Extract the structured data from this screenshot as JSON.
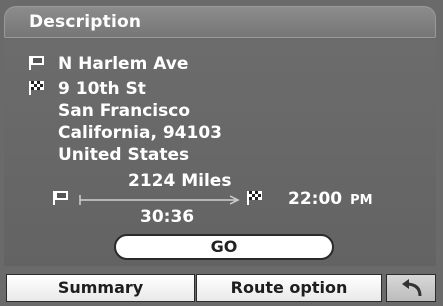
{
  "title": "Description",
  "origin": {
    "street": "N Harlem Ave",
    "icon": "start-flag-icon"
  },
  "destination": {
    "icon": "finish-flag-icon",
    "address_lines": [
      "9 10th St",
      "San Francisco",
      "California, 94103",
      "United States"
    ]
  },
  "route": {
    "distance": "2124 Miles",
    "duration": "30:36",
    "arrival_time": "22:00",
    "arrival_ampm": "PM"
  },
  "buttons": {
    "go": "GO",
    "summary": "Summary",
    "route_option": "Route option",
    "back_icon": "undo-arrow-icon"
  }
}
